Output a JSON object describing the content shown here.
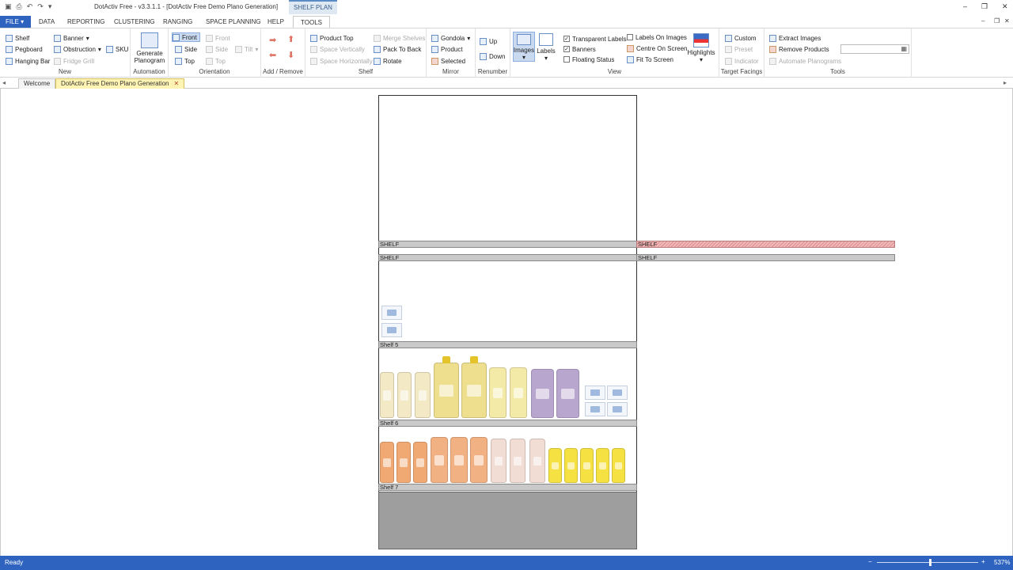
{
  "app": {
    "title": "DotActiv Free - v3.3.1.1 - [DotActiv Free Demo Plano Generation]",
    "context_tab": "SHELF PLAN"
  },
  "menu": {
    "file": "FILE",
    "tabs": [
      "DATA",
      "REPORTING",
      "CLUSTERING",
      "RANGING",
      "SPACE PLANNING",
      "HELP",
      "TOOLS"
    ]
  },
  "ribbon": {
    "new": {
      "label": "New",
      "shelf": "Shelf",
      "pegboard": "Pegboard",
      "hanging_bar": "Hanging Bar",
      "banner": "Banner",
      "obstruction": "Obstruction",
      "fridge_grill": "Fridge Grill",
      "sku": "SKU"
    },
    "automation": {
      "label": "Automation",
      "generate_1": "Generate",
      "generate_2": "Planogram"
    },
    "orientation": {
      "label": "Orientation",
      "front": "Front",
      "side": "Side",
      "top": "Top",
      "front2": "Front",
      "side2": "Side",
      "top2": "Top",
      "tilt": "Tilt"
    },
    "add_remove": {
      "label": "Add / Remove"
    },
    "shelf": {
      "label": "Shelf",
      "product_top": "Product Top",
      "space_vertically": "Space Vertically",
      "space_horizontally": "Space Horizontally",
      "merge_shelves": "Merge Shelves",
      "pack_to_back": "Pack To Back",
      "rotate": "Rotate"
    },
    "mirror": {
      "label": "Mirror",
      "gondola": "Gondola",
      "product": "Product",
      "selected": "Selected"
    },
    "renumber": {
      "label": "Renumber",
      "up": "Up",
      "down": "Down"
    },
    "view": {
      "label": "View",
      "images": "Images",
      "labels": "Labels",
      "transparent_labels": "Transparent Labels",
      "banners": "Banners",
      "floating_status": "Floating Status",
      "labels_on_images": "Labels On Images",
      "centre_on_screen": "Centre On Screen",
      "fit_to_screen": "Fit To Screen",
      "highlights": "Highlights"
    },
    "target_facings": {
      "label": "Target Facings",
      "custom": "Custom",
      "preset": "Preset",
      "indicator": "Indicator"
    },
    "tools": {
      "label": "Tools",
      "extract_images": "Extract Images",
      "remove_products": "Remove Products",
      "automate_planograms": "Automate Planograms"
    }
  },
  "doc_tabs": {
    "welcome": "Welcome",
    "active": "DotActiv Free Demo Plano Generation",
    "close": "✕"
  },
  "planogram": {
    "shelf_top_1": "SHELF",
    "shelf_top_2": "SHELF",
    "shelf_right_1": "SHELF",
    "shelf_right_2": "SHELF",
    "shelf5": "Shelf 5",
    "shelf6": "Shelf 6",
    "shelf7": "Shelf 7"
  },
  "status": {
    "text": "Ready",
    "zoom_minus": "−",
    "zoom_plus": "+",
    "zoom": "537%"
  },
  "colors": {
    "accent": "#2e64c0",
    "active_tab": "#fff4b3",
    "shelf": "#c9c9c9",
    "hatched_shelf": "#e08c8c",
    "base": "#9e9e9e"
  }
}
